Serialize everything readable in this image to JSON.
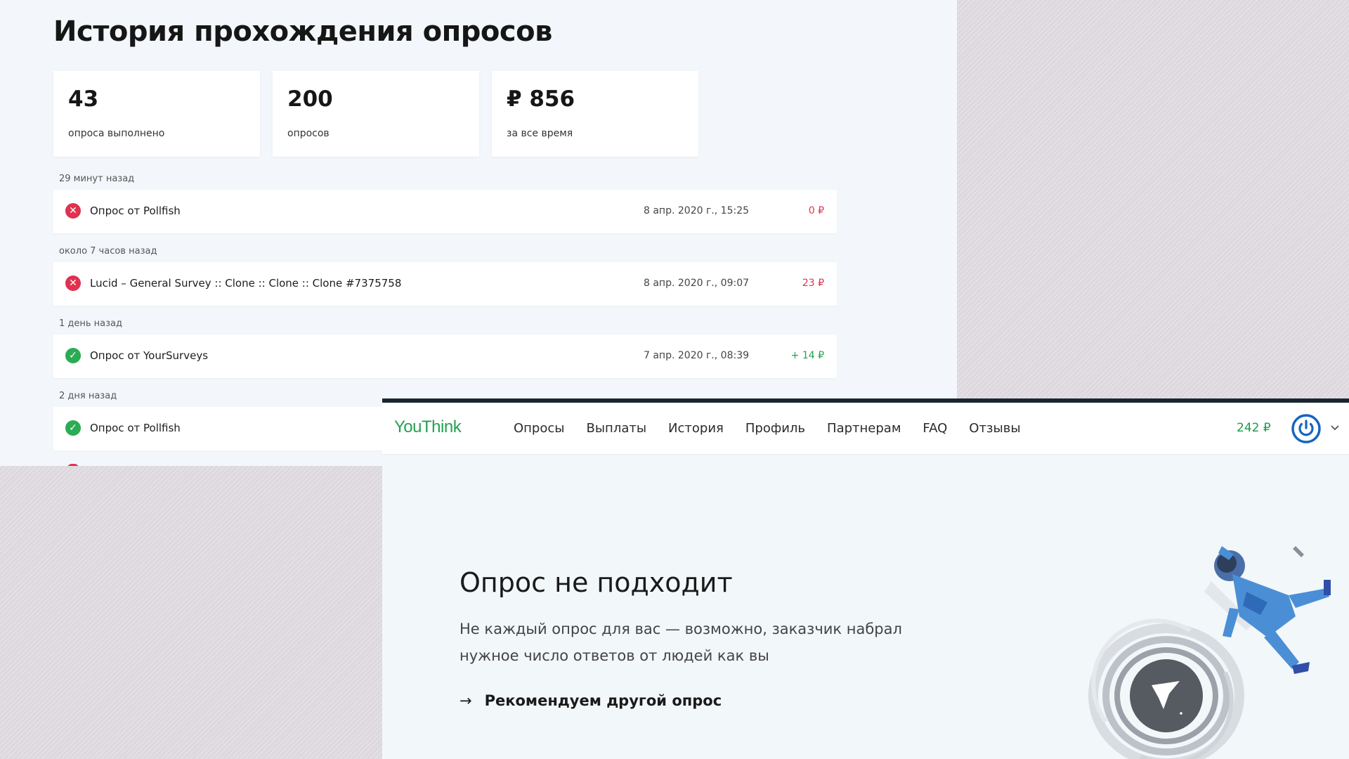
{
  "history": {
    "title": "История прохождения опросов",
    "stats": [
      {
        "value": "43",
        "label": "опроса выполнено"
      },
      {
        "value": "200",
        "label": "опросов"
      },
      {
        "value": "₽ 856",
        "label": "за все время"
      }
    ],
    "groups": [
      {
        "label": "29 минут назад",
        "title": "Опрос от Pollfish",
        "date": "8 апр. 2020 г., 15:25",
        "amount": "0 ₽",
        "status": "fail"
      },
      {
        "label": "около 7 часов назад",
        "title": "Lucid – General Survey :: Clone :: Clone :: Clone #7375758",
        "date": "8 апр. 2020 г., 09:07",
        "amount": "23 ₽",
        "status": "fail"
      },
      {
        "label": "1 день назад",
        "title": "Опрос от YourSurveys",
        "date": "7 апр. 2020 г., 08:39",
        "amount": "+ 14 ₽",
        "status": "ok"
      },
      {
        "label": "2 дня назад",
        "title": "Опрос от Pollfish",
        "date": "",
        "amount": "",
        "status": "ok"
      }
    ]
  },
  "youthink": {
    "logo": "YouThink",
    "nav": [
      "Опросы",
      "Выплаты",
      "История",
      "Профиль",
      "Партнерам",
      "FAQ",
      "Отзывы"
    ],
    "balance": "242 ₽",
    "heading": "Опрос не подходит",
    "description": "Не каждый опрос для вас — возможно, заказчик набрал нужное число ответов от людей как вы",
    "link_label": "Рекомендуем другой опрос",
    "link_arrow": "→"
  },
  "colors": {
    "accent_green": "#23a152",
    "status_red": "#df3150",
    "status_green": "#2bab54",
    "power_blue": "#1565c0"
  },
  "icons": {
    "fail": "close-circle-icon",
    "ok": "check-circle-icon",
    "power": "power-icon",
    "dropdown": "chevron-down-icon"
  }
}
